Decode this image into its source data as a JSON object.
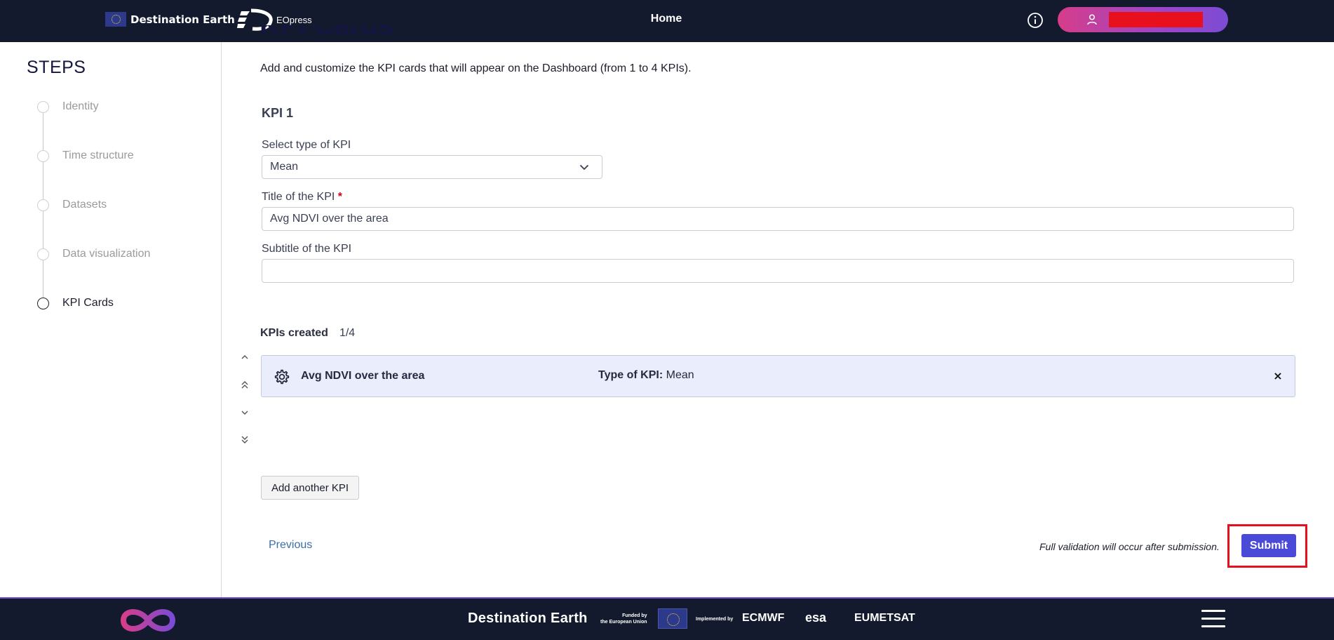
{
  "header": {
    "brand": "Destination Earth",
    "app_name": "EOpress",
    "nav_home": "Home",
    "user_name": "████████"
  },
  "sidebar": {
    "title": "STEPS",
    "steps": [
      {
        "label": "Identity",
        "active": false
      },
      {
        "label": "Time structure",
        "active": false
      },
      {
        "label": "Datasets",
        "active": false
      },
      {
        "label": "Data visualization",
        "active": false
      },
      {
        "label": "KPI Cards",
        "active": true
      }
    ]
  },
  "main": {
    "page_title": "KPI Cards",
    "intro": "Add and customize the KPI cards that will appear on the Dashboard (from 1 to 4 KPIs).",
    "kpi_heading": "KPI 1",
    "type_label": "Select type of KPI",
    "type_value": "Mean",
    "title_label": "Title of the KPI",
    "required_mark": "*",
    "title_value": "Avg NDVI over the area",
    "subtitle_label": "Subtitle of the KPI",
    "subtitle_value": "",
    "kpis_created_label": "KPIs created",
    "kpis_created_count": "1/4",
    "kpi_cards": [
      {
        "title": "Avg NDVI over the area",
        "type_label": "Type of KPI:",
        "type_value": "Mean",
        "close": "×"
      }
    ],
    "add_button": "Add another KPI",
    "previous": "Previous",
    "validation_note": "Full validation will occur after submission.",
    "submit": "Submit"
  },
  "footer": {
    "brand": "Destination Earth",
    "funded_line1": "Funded by",
    "funded_line2": "the European Union",
    "implemented_by": "Implemented by",
    "partners": [
      "ECMWF",
      "esa",
      "EUMETSAT"
    ]
  },
  "colors": {
    "topbar": "#131a2e",
    "accent": "#4b4ad8",
    "card_bg": "#eaedfb",
    "highlight": "#e5101d",
    "link": "#3a6ea8"
  }
}
